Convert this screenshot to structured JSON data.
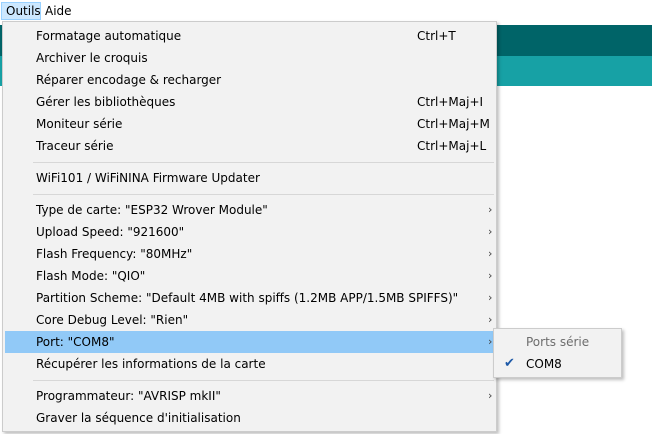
{
  "menubar": {
    "outils": "Outils",
    "aide": "Aide"
  },
  "menu": {
    "items": [
      {
        "label": "Formatage automatique",
        "shortcut": "Ctrl+T"
      },
      {
        "label": "Archiver le croquis",
        "shortcut": ""
      },
      {
        "label": "Réparer encodage & recharger",
        "shortcut": ""
      },
      {
        "label": "Gérer les bibliothèques",
        "shortcut": "Ctrl+Maj+I"
      },
      {
        "label": "Moniteur série",
        "shortcut": "Ctrl+Maj+M"
      },
      {
        "label": "Traceur série",
        "shortcut": "Ctrl+Maj+L"
      },
      {
        "label": "WiFi101 / WiFiNINA Firmware Updater",
        "shortcut": ""
      },
      {
        "label": "Type de carte: \"ESP32 Wrover Module\"",
        "submenu": true
      },
      {
        "label": "Upload Speed: \"921600\"",
        "submenu": true
      },
      {
        "label": "Flash Frequency: \"80MHz\"",
        "submenu": true
      },
      {
        "label": "Flash Mode: \"QIO\"",
        "submenu": true
      },
      {
        "label": "Partition Scheme: \"Default 4MB with spiffs (1.2MB APP/1.5MB SPIFFS)\"",
        "submenu": true
      },
      {
        "label": "Core Debug Level: \"Rien\"",
        "submenu": true
      },
      {
        "label": "Port: \"COM8\"",
        "submenu": true,
        "highlighted": true
      },
      {
        "label": "Récupérer les informations de la carte",
        "shortcut": ""
      },
      {
        "label": "Programmateur: \"AVRISP mkII\"",
        "submenu": true
      },
      {
        "label": "Graver la séquence d'initialisation",
        "shortcut": ""
      }
    ],
    "arrow_glyph": "›"
  },
  "submenu": {
    "header": "Ports série",
    "items": [
      {
        "label": "COM8",
        "checked": true
      }
    ],
    "check_glyph": "✔"
  },
  "colors": {
    "highlight": "#91c9f7",
    "menu_bg": "#f2f2f2",
    "teal_dark": "#006468",
    "teal": "#17a1a5"
  }
}
